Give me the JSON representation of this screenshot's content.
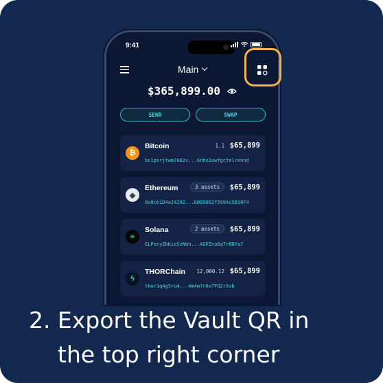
{
  "status_bar": {
    "time": "9:41"
  },
  "header": {
    "vault_name": "Main"
  },
  "balance": {
    "amount": "$365,899.00"
  },
  "actions": {
    "send_label": "SEND",
    "swap_label": "SWAP"
  },
  "assets": [
    {
      "name": "Bitcoin",
      "badge": "1.1",
      "badge_style": "plain",
      "value": "$65,899",
      "address": "bc1psrjtwm7682v...6nhx2uwfgcfelrennd",
      "icon": "bitcoin-icon",
      "color": "#f7931a",
      "glyph": "₿"
    },
    {
      "name": "Ethereum",
      "badge": "3 assets",
      "badge_style": "pill",
      "value": "$65,899",
      "address": "0x0cb1D4a24292...bB89062f599Ac5B10F4",
      "icon": "ethereum-icon",
      "color": "#e8ecf2",
      "glyph": "◆"
    },
    {
      "name": "Solana",
      "badge": "2 assets",
      "badge_style": "pill",
      "value": "$65,899",
      "address": "ELPecyZbKieSzNUn...AGPZna6q7r8DYa7",
      "icon": "solana-icon",
      "color": "#000000",
      "glyph": "≡"
    },
    {
      "name": "THORChain",
      "badge": "12,000.12",
      "badge_style": "plain",
      "value": "$65,899",
      "address": "thor1q4g5ru4...4m4m7r6x7FQ2r5vb",
      "icon": "thorchain-icon",
      "color": "#0a1326",
      "glyph": "ϟ"
    }
  ],
  "caption": {
    "number": "2.",
    "line1": "Export the Vault QR in",
    "line2": "the top right corner"
  },
  "colors": {
    "background": "#13284e",
    "accent": "#45d6e3",
    "highlight": "#f2b34c"
  }
}
